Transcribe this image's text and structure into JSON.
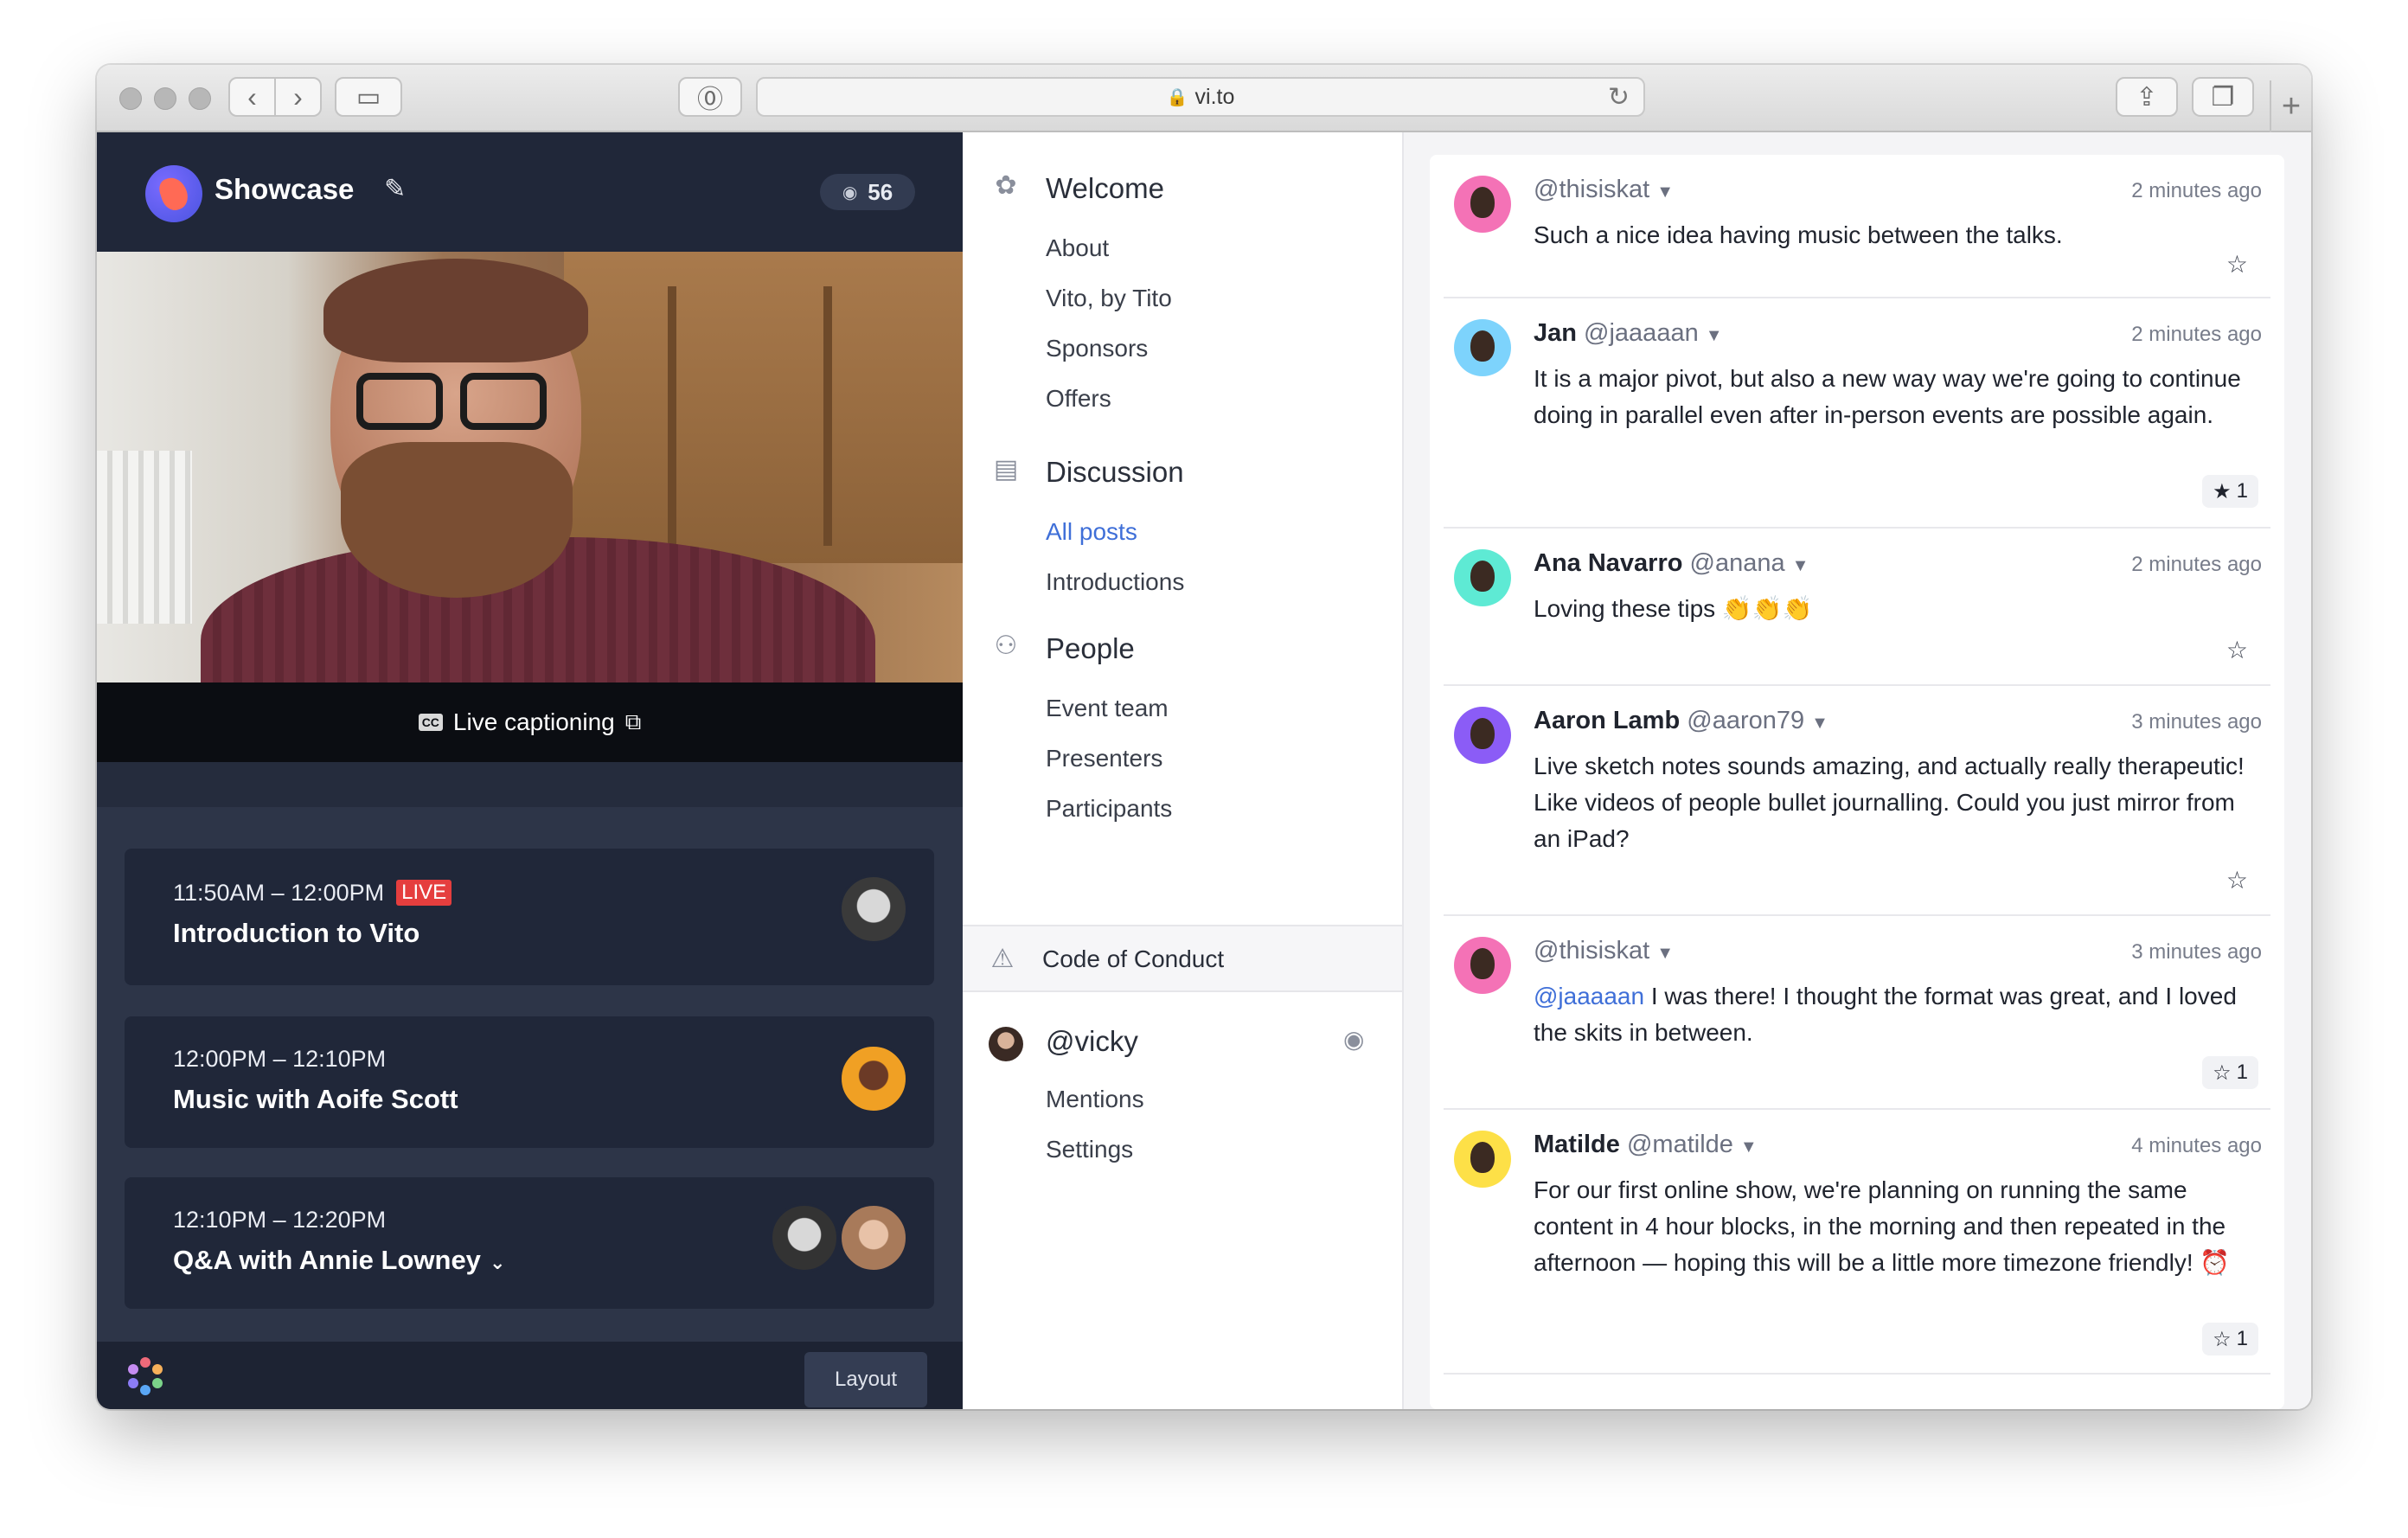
{
  "browser": {
    "url": "vi.to",
    "lock_icon": "lock-icon",
    "reload_icon": "reload-icon"
  },
  "header": {
    "title": "Showcase",
    "viewer_count": "56"
  },
  "video": {
    "caption_label": "Live captioning"
  },
  "sessions": [
    {
      "time": "11:50AM – 12:00PM",
      "badge": "LIVE",
      "title": "Introduction to Vito"
    },
    {
      "time": "12:00PM – 12:10PM",
      "badge": "",
      "title": "Music with Aoife Scott"
    },
    {
      "time": "12:10PM – 12:20PM",
      "badge": "",
      "title": "Q&A with Annie Lowney"
    }
  ],
  "footer": {
    "layout_label": "Layout"
  },
  "nav": {
    "welcome": {
      "label": "Welcome",
      "items": [
        "About",
        "Vito, by Tito",
        "Sponsors",
        "Offers"
      ]
    },
    "discussion": {
      "label": "Discussion",
      "items": [
        "All posts",
        "Introductions"
      ]
    },
    "people": {
      "label": "People",
      "items": [
        "Event team",
        "Presenters",
        "Participants"
      ]
    },
    "code_of_conduct": "Code of Conduct",
    "user": {
      "handle": "@vicky",
      "items": [
        "Mentions",
        "Settings"
      ]
    }
  },
  "posts": [
    {
      "name": "",
      "handle": "@thisiskat",
      "time": "2 minutes ago",
      "mention": "",
      "text": "Such a nice idea having music between the talks.",
      "stars": "",
      "avatar_color": "#f472b6"
    },
    {
      "name": "Jan",
      "handle": "@jaaaaan",
      "time": "2 minutes ago",
      "mention": "",
      "text": "It is a major pivot, but also a new way way we're going to continue doing in parallel even after in-person events are possible again.",
      "stars": "1",
      "avatar_color": "#7dd3fc"
    },
    {
      "name": "Ana Navarro",
      "handle": "@anana",
      "time": "2 minutes ago",
      "mention": "",
      "text": "Loving these tips 👏👏👏",
      "stars": "",
      "avatar_color": "#5eead4"
    },
    {
      "name": "Aaron Lamb",
      "handle": "@aaron79",
      "time": "3 minutes ago",
      "mention": "",
      "text": "Live sketch notes sounds amazing, and actually really therapeutic! Like videos of people bullet journalling. Could you just mirror from an iPad?",
      "stars": "",
      "avatar_color": "#8b5cf6"
    },
    {
      "name": "",
      "handle": "@thisiskat",
      "time": "3 minutes ago",
      "mention": "@jaaaaan",
      "text": " I was there! I thought the format was great, and I loved the skits in between.",
      "stars": "1",
      "avatar_color": "#f472b6"
    },
    {
      "name": "Matilde",
      "handle": "@matilde",
      "time": "4 minutes ago",
      "mention": "",
      "text": "For our first online show, we're planning on running the same content in 4 hour blocks, in the morning and then repeated in the afternoon — hoping this will be a little more timezone friendly! ⏰",
      "stars": "1",
      "avatar_color": "#fde047"
    }
  ],
  "colors": {
    "panel_dark": "#2d3548",
    "header_dark": "#202739",
    "accent_blue": "#3f6fd8",
    "live_red": "#e53e3e"
  }
}
